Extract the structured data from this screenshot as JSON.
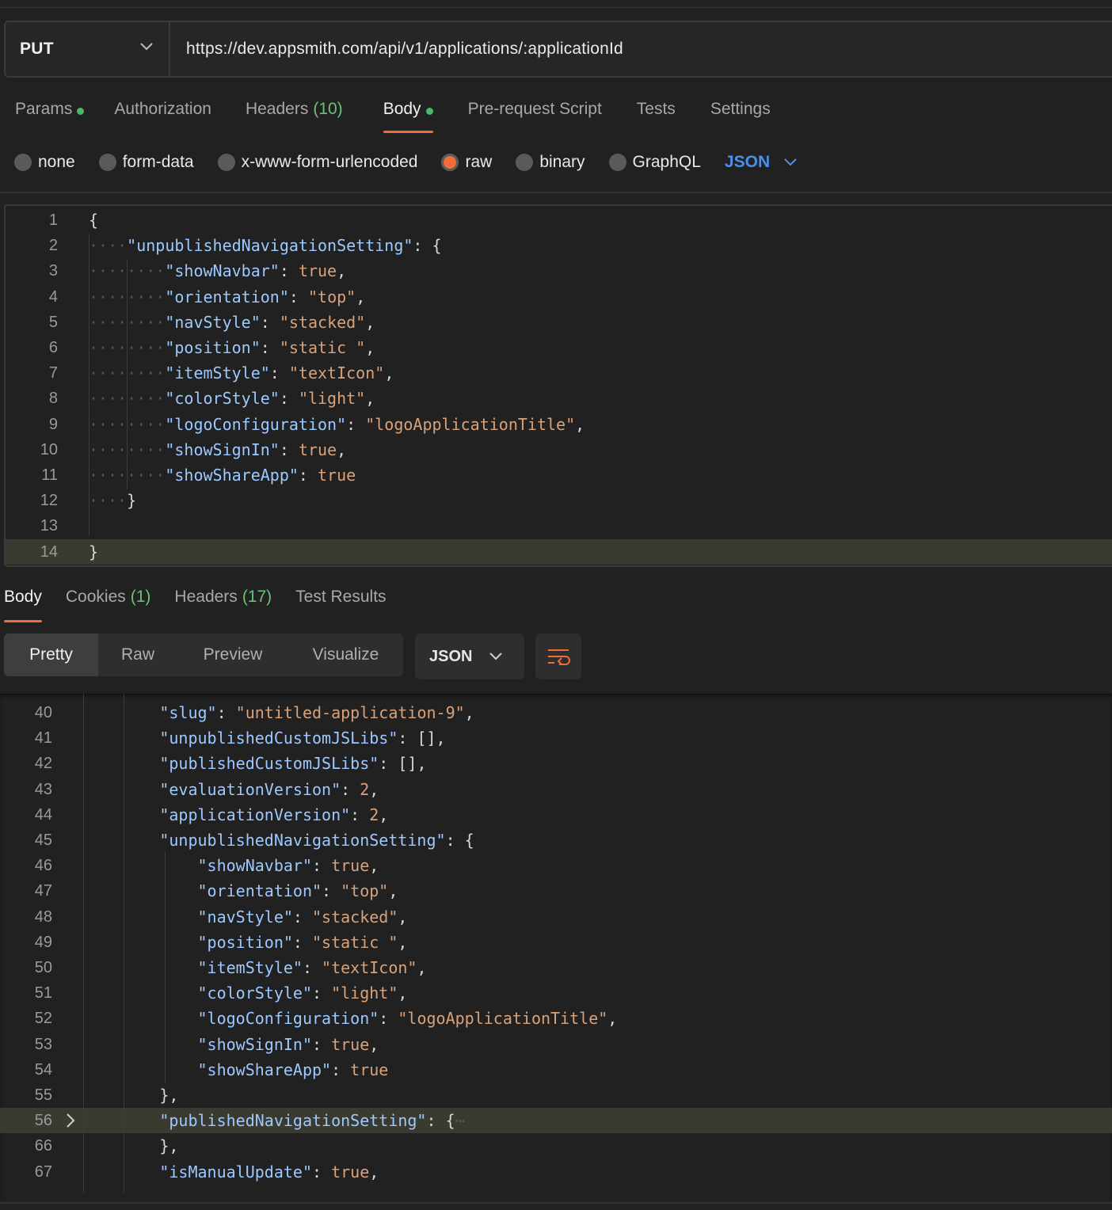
{
  "request": {
    "method": "PUT",
    "url": "https://dev.appsmith.com/api/v1/applications/:applicationId"
  },
  "request_tabs": [
    {
      "label": "Params",
      "dot": true
    },
    {
      "label": "Authorization"
    },
    {
      "label": "Headers",
      "count": "(10)"
    },
    {
      "label": "Body",
      "dot": true,
      "active": true
    },
    {
      "label": "Pre-request Script"
    },
    {
      "label": "Tests"
    },
    {
      "label": "Settings"
    }
  ],
  "body_types": [
    {
      "label": "none"
    },
    {
      "label": "form-data"
    },
    {
      "label": "x-www-form-urlencoded"
    },
    {
      "label": "raw",
      "checked": true
    },
    {
      "label": "binary"
    },
    {
      "label": "GraphQL"
    }
  ],
  "body_format": "JSON",
  "request_body_lines": [
    {
      "n": "1",
      "indent": 0,
      "parts": [
        [
          "p",
          "{"
        ]
      ]
    },
    {
      "n": "2",
      "indent": 1,
      "parts": [
        [
          "k",
          "\"unpublishedNavigationSetting\""
        ],
        [
          "p",
          ": {"
        ]
      ]
    },
    {
      "n": "3",
      "indent": 2,
      "parts": [
        [
          "k",
          "\"showNavbar\""
        ],
        [
          "p",
          ": "
        ],
        [
          "b",
          "true"
        ],
        [
          "p",
          ","
        ]
      ]
    },
    {
      "n": "4",
      "indent": 2,
      "parts": [
        [
          "k",
          "\"orientation\""
        ],
        [
          "p",
          ": "
        ],
        [
          "s",
          "\"top\""
        ],
        [
          "p",
          ","
        ]
      ]
    },
    {
      "n": "5",
      "indent": 2,
      "parts": [
        [
          "k",
          "\"navStyle\""
        ],
        [
          "p",
          ": "
        ],
        [
          "s",
          "\"stacked\""
        ],
        [
          "p",
          ","
        ]
      ]
    },
    {
      "n": "6",
      "indent": 2,
      "parts": [
        [
          "k",
          "\"position\""
        ],
        [
          "p",
          ": "
        ],
        [
          "s",
          "\"static \""
        ],
        [
          "p",
          ","
        ]
      ]
    },
    {
      "n": "7",
      "indent": 2,
      "parts": [
        [
          "k",
          "\"itemStyle\""
        ],
        [
          "p",
          ": "
        ],
        [
          "s",
          "\"textIcon\""
        ],
        [
          "p",
          ","
        ]
      ]
    },
    {
      "n": "8",
      "indent": 2,
      "parts": [
        [
          "k",
          "\"colorStyle\""
        ],
        [
          "p",
          ": "
        ],
        [
          "s",
          "\"light\""
        ],
        [
          "p",
          ","
        ]
      ]
    },
    {
      "n": "9",
      "indent": 2,
      "parts": [
        [
          "k",
          "\"logoConfiguration\""
        ],
        [
          "p",
          ": "
        ],
        [
          "s",
          "\"logoApplicationTitle\""
        ],
        [
          "p",
          ","
        ]
      ]
    },
    {
      "n": "10",
      "indent": 2,
      "parts": [
        [
          "k",
          "\"showSignIn\""
        ],
        [
          "p",
          ": "
        ],
        [
          "b",
          "true"
        ],
        [
          "p",
          ","
        ]
      ]
    },
    {
      "n": "11",
      "indent": 2,
      "parts": [
        [
          "k",
          "\"showShareApp\""
        ],
        [
          "p",
          ": "
        ],
        [
          "b",
          "true"
        ]
      ]
    },
    {
      "n": "12",
      "indent": 1,
      "parts": [
        [
          "p",
          "}"
        ]
      ]
    },
    {
      "n": "13",
      "indent": 0,
      "parts": []
    },
    {
      "n": "14",
      "indent": 0,
      "parts": [
        [
          "p",
          "}"
        ]
      ],
      "highlight": true
    }
  ],
  "response_tabs": [
    {
      "label": "Body",
      "active": true
    },
    {
      "label": "Cookies",
      "count": "(1)"
    },
    {
      "label": "Headers",
      "count": "(17)"
    },
    {
      "label": "Test Results"
    }
  ],
  "view_modes": [
    "Pretty",
    "Raw",
    "Preview",
    "Visualize"
  ],
  "response_format": "JSON",
  "response_body_lines": [
    {
      "n": "40",
      "indent": 2,
      "parts": [
        [
          "k",
          "\"slug\""
        ],
        [
          "p",
          ": "
        ],
        [
          "s",
          "\"untitled-application-9\""
        ],
        [
          "p",
          ","
        ]
      ]
    },
    {
      "n": "41",
      "indent": 2,
      "parts": [
        [
          "k",
          "\"unpublishedCustomJSLibs\""
        ],
        [
          "p",
          ": [],"
        ]
      ]
    },
    {
      "n": "42",
      "indent": 2,
      "parts": [
        [
          "k",
          "\"publishedCustomJSLibs\""
        ],
        [
          "p",
          ": [],"
        ]
      ]
    },
    {
      "n": "43",
      "indent": 2,
      "parts": [
        [
          "k",
          "\"evaluationVersion\""
        ],
        [
          "p",
          ": "
        ],
        [
          "n",
          "2"
        ],
        [
          "p",
          ","
        ]
      ]
    },
    {
      "n": "44",
      "indent": 2,
      "parts": [
        [
          "k",
          "\"applicationVersion\""
        ],
        [
          "p",
          ": "
        ],
        [
          "n",
          "2"
        ],
        [
          "p",
          ","
        ]
      ]
    },
    {
      "n": "45",
      "indent": 2,
      "parts": [
        [
          "k",
          "\"unpublishedNavigationSetting\""
        ],
        [
          "p",
          ": {"
        ]
      ]
    },
    {
      "n": "46",
      "indent": 3,
      "parts": [
        [
          "k",
          "\"showNavbar\""
        ],
        [
          "p",
          ": "
        ],
        [
          "b",
          "true"
        ],
        [
          "p",
          ","
        ]
      ]
    },
    {
      "n": "47",
      "indent": 3,
      "parts": [
        [
          "k",
          "\"orientation\""
        ],
        [
          "p",
          ": "
        ],
        [
          "s",
          "\"top\""
        ],
        [
          "p",
          ","
        ]
      ]
    },
    {
      "n": "48",
      "indent": 3,
      "parts": [
        [
          "k",
          "\"navStyle\""
        ],
        [
          "p",
          ": "
        ],
        [
          "s",
          "\"stacked\""
        ],
        [
          "p",
          ","
        ]
      ]
    },
    {
      "n": "49",
      "indent": 3,
      "parts": [
        [
          "k",
          "\"position\""
        ],
        [
          "p",
          ": "
        ],
        [
          "s",
          "\"static \""
        ],
        [
          "p",
          ","
        ]
      ]
    },
    {
      "n": "50",
      "indent": 3,
      "parts": [
        [
          "k",
          "\"itemStyle\""
        ],
        [
          "p",
          ": "
        ],
        [
          "s",
          "\"textIcon\""
        ],
        [
          "p",
          ","
        ]
      ]
    },
    {
      "n": "51",
      "indent": 3,
      "parts": [
        [
          "k",
          "\"colorStyle\""
        ],
        [
          "p",
          ": "
        ],
        [
          "s",
          "\"light\""
        ],
        [
          "p",
          ","
        ]
      ]
    },
    {
      "n": "52",
      "indent": 3,
      "parts": [
        [
          "k",
          "\"logoConfiguration\""
        ],
        [
          "p",
          ": "
        ],
        [
          "s",
          "\"logoApplicationTitle\""
        ],
        [
          "p",
          ","
        ]
      ]
    },
    {
      "n": "53",
      "indent": 3,
      "parts": [
        [
          "k",
          "\"showSignIn\""
        ],
        [
          "p",
          ": "
        ],
        [
          "b",
          "true"
        ],
        [
          "p",
          ","
        ]
      ]
    },
    {
      "n": "54",
      "indent": 3,
      "parts": [
        [
          "k",
          "\"showShareApp\""
        ],
        [
          "p",
          ": "
        ],
        [
          "b",
          "true"
        ]
      ]
    },
    {
      "n": "55",
      "indent": 2,
      "parts": [
        [
          "p",
          "},"
        ]
      ]
    },
    {
      "n": "56",
      "indent": 2,
      "parts": [
        [
          "k",
          "\"publishedNavigationSetting\""
        ],
        [
          "p",
          ": {"
        ],
        [
          "ws",
          "⋯"
        ]
      ],
      "highlight": true,
      "folded": true
    },
    {
      "n": "66",
      "indent": 2,
      "parts": [
        [
          "p",
          "},"
        ]
      ]
    },
    {
      "n": "67",
      "indent": 2,
      "parts": [
        [
          "k",
          "\"isManualUpdate\""
        ],
        [
          "p",
          ": "
        ],
        [
          "b",
          "true"
        ],
        [
          "p",
          ","
        ]
      ]
    }
  ],
  "colors": {
    "accent": "#f26b3a",
    "status_green": "#49b86a",
    "link_blue": "#4d8fe6"
  }
}
